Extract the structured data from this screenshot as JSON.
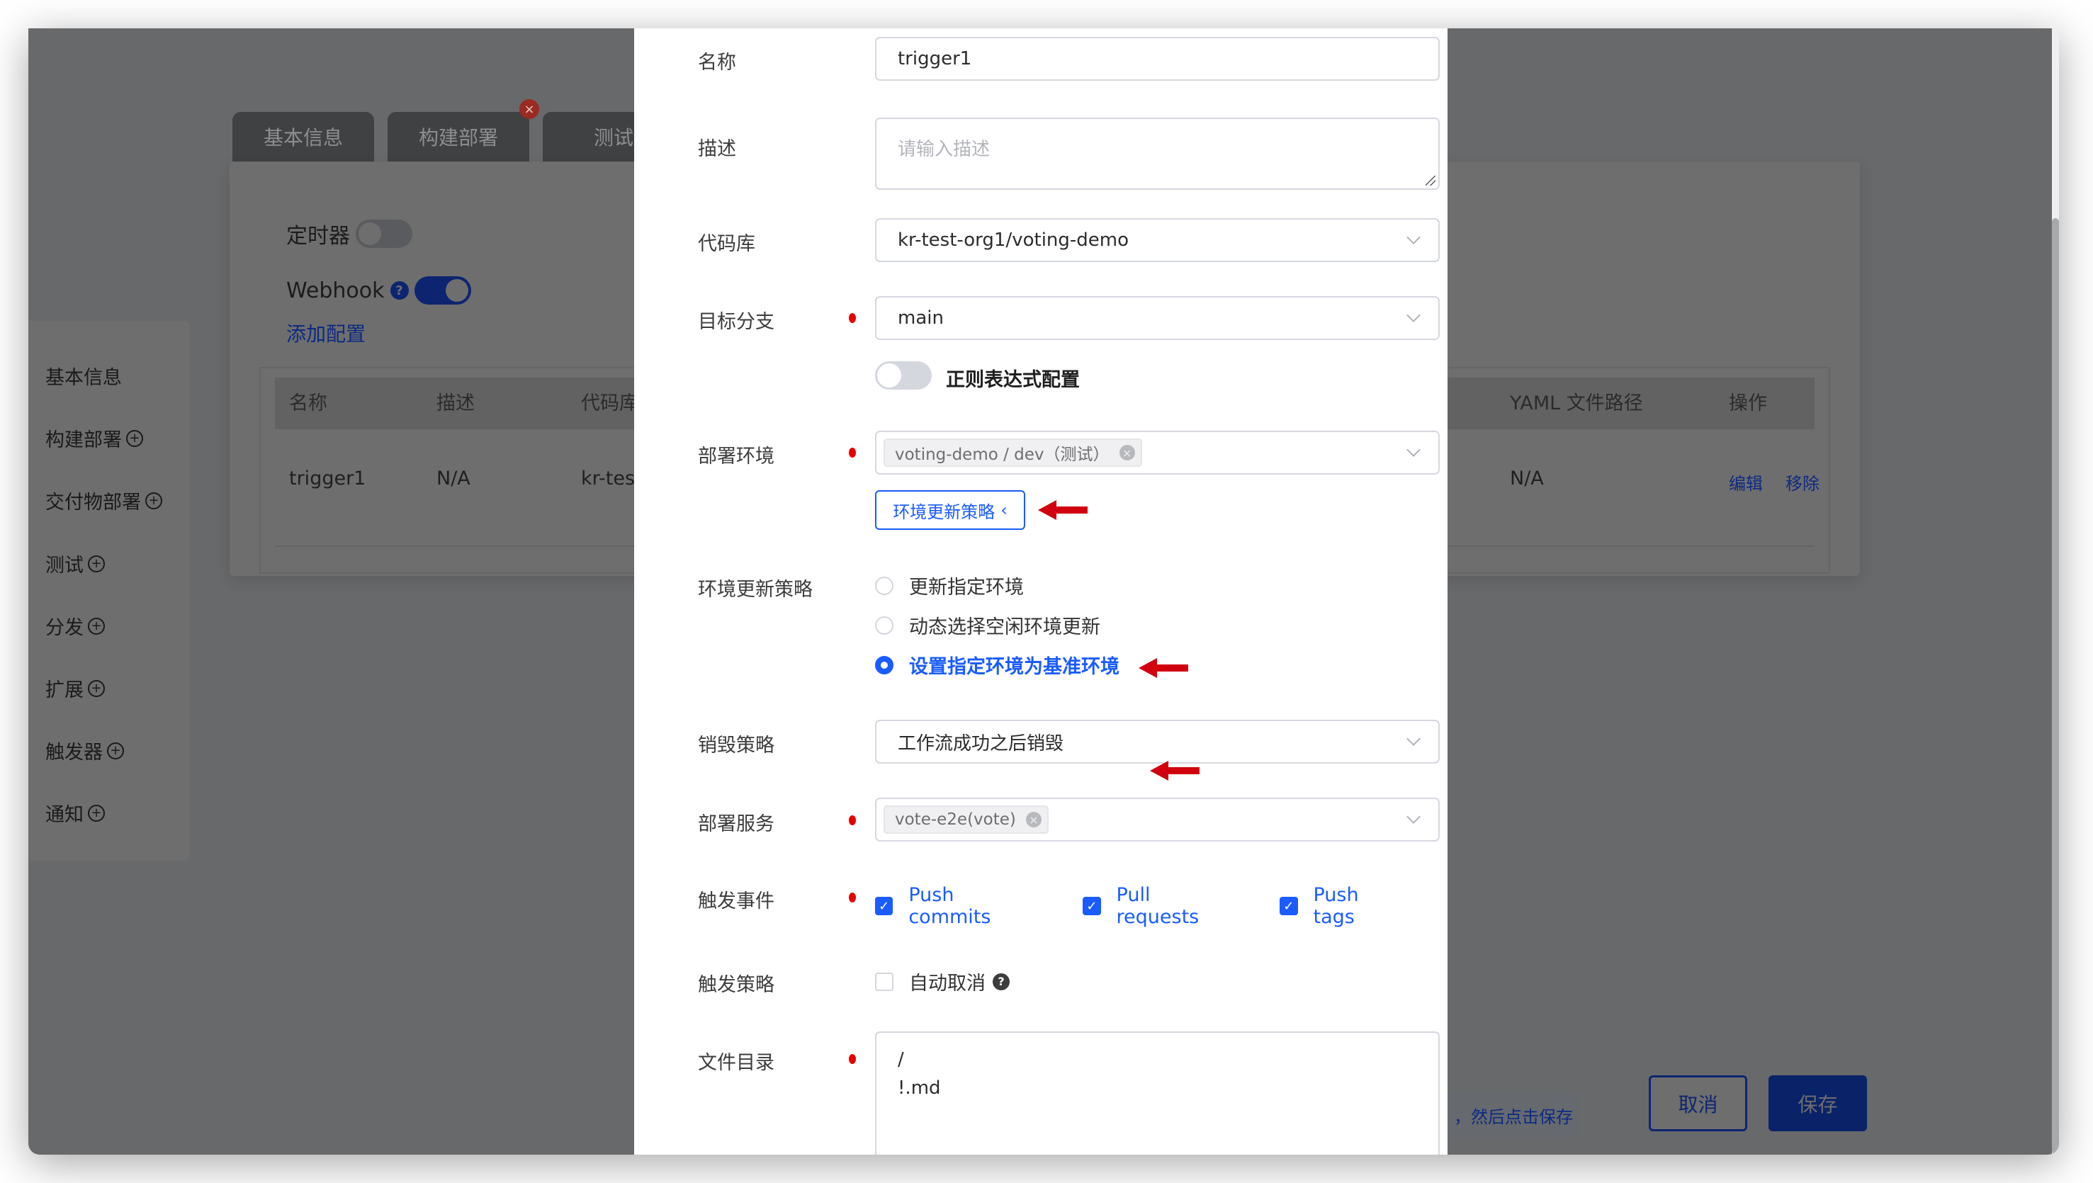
{
  "background": {
    "tabs": [
      {
        "label": "基本信息",
        "error": false
      },
      {
        "label": "构建部署",
        "error": true
      },
      {
        "label": "测试",
        "error": false
      }
    ],
    "timer_label": "定时器",
    "timer_enabled": false,
    "webhook_label": "Webhook",
    "webhook_enabled": true,
    "add_config_label": "添加配置",
    "table": {
      "headers": [
        "名称",
        "描述",
        "代码库",
        "YAML 文件路径",
        "操作"
      ],
      "row": {
        "name": "trigger1",
        "description": "N/A",
        "repo_partial": "kr-tes",
        "yaml_path": "N/A",
        "actions": [
          "编辑",
          "移除"
        ]
      }
    },
    "sidebar": {
      "items": [
        {
          "label": "基本信息",
          "addable": false
        },
        {
          "label": "构建部署",
          "addable": true
        },
        {
          "label": "交付物部署",
          "addable": true
        },
        {
          "label": "测试",
          "addable": true
        },
        {
          "label": "分发",
          "addable": true
        },
        {
          "label": "扩展",
          "addable": true
        },
        {
          "label": "触发器",
          "addable": true
        },
        {
          "label": "通知",
          "addable": true
        }
      ]
    },
    "hint_partial": "，然后点击保存",
    "cancel_label": "取消",
    "save_label": "保存"
  },
  "modal": {
    "name": {
      "label": "名称",
      "value": "trigger1"
    },
    "description": {
      "label": "描述",
      "placeholder": "请输入描述",
      "value": ""
    },
    "repo": {
      "label": "代码库",
      "value": "kr-test-org1/voting-demo"
    },
    "branch": {
      "label": "目标分支",
      "value": "main",
      "required": true
    },
    "regex": {
      "label": "正则表达式配置",
      "enabled": false
    },
    "deploy_env": {
      "label": "部署环境",
      "required": true,
      "tags": [
        "voting-demo / dev（测试）"
      ]
    },
    "strategy_button": {
      "label": "环境更新策略",
      "icon": "chevron-left"
    },
    "env_update_strategy": {
      "label": "环境更新策略",
      "options": [
        {
          "label": "更新指定环境",
          "checked": false
        },
        {
          "label": "动态选择空闲环境更新",
          "checked": false
        },
        {
          "label": "设置指定环境为基准环境",
          "checked": true
        }
      ]
    },
    "destroy_strategy": {
      "label": "销毁策略",
      "value": "工作流成功之后销毁"
    },
    "deploy_service": {
      "label": "部署服务",
      "required": true,
      "tags": [
        "vote-e2e(vote)"
      ]
    },
    "trigger_events": {
      "label": "触发事件",
      "required": true,
      "options": [
        {
          "label": "Push commits",
          "checked": true
        },
        {
          "label": "Pull requests",
          "checked": true
        },
        {
          "label": "Push tags",
          "checked": true
        }
      ]
    },
    "trigger_strategy": {
      "label": "触发策略",
      "option": {
        "label": "自动取消",
        "checked": false
      }
    },
    "file_dir": {
      "label": "文件目录",
      "required": true,
      "value": "/\n!.md"
    }
  },
  "colors": {
    "accent": "#1a5cff",
    "required": "#e60000",
    "annotation_arrow": "#d0000f"
  }
}
